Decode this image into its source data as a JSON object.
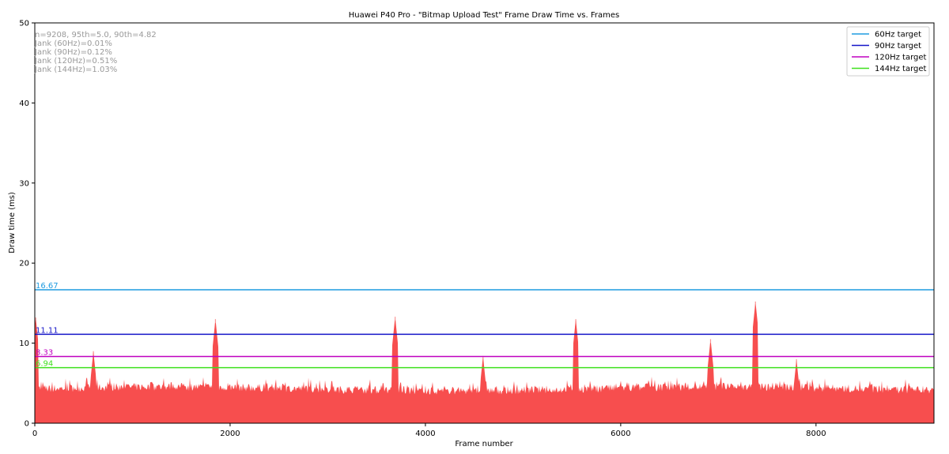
{
  "chart_data": {
    "type": "area",
    "title": "Huawei P40 Pro - \"Bitmap Upload Test\" Frame Draw Time vs. Frames",
    "xlabel": "Frame number",
    "ylabel": "Draw time (ms)",
    "xlim": [
      0,
      9208
    ],
    "ylim": [
      0,
      50
    ],
    "x_ticks": [
      0,
      2000,
      4000,
      6000,
      8000
    ],
    "y_ticks": [
      0,
      10,
      20,
      30,
      40,
      50
    ],
    "grid": false,
    "legend_position": "top-right",
    "stats": [
      "n=9208, 95th=5.0, 90th=4.82",
      "Jank (60Hz)=0.01%",
      "Jank (90Hz)=0.12%",
      "Jank (120Hz)=0.51%",
      "Jank (144Hz)=1.03%"
    ],
    "targets": [
      {
        "name": "60Hz target",
        "value": 16.67,
        "label": "16.67",
        "color": "#1f9be0"
      },
      {
        "name": "90Hz target",
        "value": 11.11,
        "label": "11.11",
        "color": "#1515c8"
      },
      {
        "name": "120Hz target",
        "value": 8.33,
        "label": "8.33",
        "color": "#c000c0"
      },
      {
        "name": "144Hz target",
        "value": 6.94,
        "label": "6.94",
        "color": "#3ee01c"
      }
    ],
    "series": {
      "color": "#f74e4e",
      "baseline_ms": 3.8,
      "spikes": [
        {
          "x": 10,
          "y": 13.2
        },
        {
          "x": 1850,
          "y": 13.0
        },
        {
          "x": 3690,
          "y": 13.3
        },
        {
          "x": 5540,
          "y": 13.0
        },
        {
          "x": 7380,
          "y": 15.2
        },
        {
          "x": 6920,
          "y": 10.5
        },
        {
          "x": 4590,
          "y": 8.4
        },
        {
          "x": 600,
          "y": 9.0
        },
        {
          "x": 7800,
          "y": 8.0
        }
      ]
    }
  }
}
